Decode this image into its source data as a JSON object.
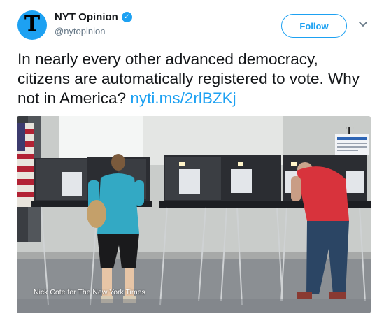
{
  "account": {
    "display_name": "NYT Opinion",
    "handle": "@nytopinion",
    "avatar_letter": "T",
    "verified": true
  },
  "follow_label": "Follow",
  "tweet": {
    "text": "In nearly every other advanced democracy, citizens are automatically registered to vote. Why not in America?",
    "link": "nyti.ms/2rlBZKj"
  },
  "media": {
    "credit": "Nick Cote for The New York Times",
    "watermark_letter": "T"
  },
  "colors": {
    "accent": "#1da1f2",
    "text": "#14171a",
    "secondary": "#657786"
  },
  "icons": {
    "verified": "verified-badge-icon",
    "caret": "chevron-down-icon"
  }
}
